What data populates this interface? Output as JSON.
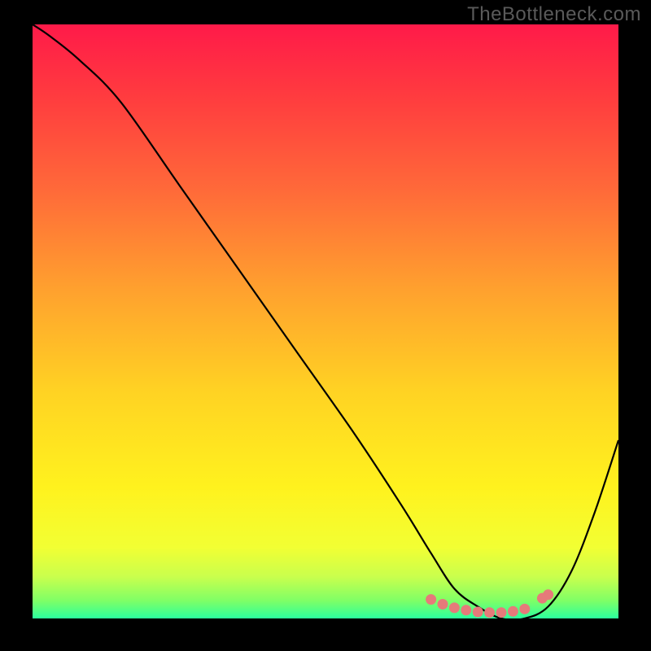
{
  "watermark": "TheBottleneck.com",
  "chart_data": {
    "type": "line",
    "title": "",
    "xlabel": "",
    "ylabel": "",
    "xlim": [
      0,
      100
    ],
    "ylim": [
      0,
      100
    ],
    "grid": false,
    "background_gradient": {
      "stops": [
        {
          "offset": 0.0,
          "color": "#ff1a49"
        },
        {
          "offset": 0.12,
          "color": "#ff3b3f"
        },
        {
          "offset": 0.28,
          "color": "#ff6a39"
        },
        {
          "offset": 0.45,
          "color": "#ffa22e"
        },
        {
          "offset": 0.62,
          "color": "#ffd323"
        },
        {
          "offset": 0.78,
          "color": "#fff21e"
        },
        {
          "offset": 0.88,
          "color": "#f2ff33"
        },
        {
          "offset": 0.93,
          "color": "#c9ff4d"
        },
        {
          "offset": 0.97,
          "color": "#7fff66"
        },
        {
          "offset": 1.0,
          "color": "#2bff9e"
        }
      ]
    },
    "series": [
      {
        "name": "bottleneck-curve",
        "color": "#000000",
        "x": [
          0,
          3,
          8,
          15,
          25,
          35,
          45,
          55,
          63,
          68,
          72,
          76,
          80,
          84,
          88,
          92,
          96,
          100
        ],
        "y": [
          100,
          98,
          94,
          87,
          73,
          59,
          45,
          31,
          19,
          11,
          5,
          2,
          0,
          0,
          2,
          8,
          18,
          30
        ]
      }
    ],
    "markers": {
      "name": "valley-markers",
      "color": "#e67a7a",
      "points": [
        {
          "x": 68,
          "y": 3.2
        },
        {
          "x": 70,
          "y": 2.4
        },
        {
          "x": 72,
          "y": 1.8
        },
        {
          "x": 74,
          "y": 1.4
        },
        {
          "x": 76,
          "y": 1.1
        },
        {
          "x": 78,
          "y": 1.0
        },
        {
          "x": 80,
          "y": 1.0
        },
        {
          "x": 82,
          "y": 1.2
        },
        {
          "x": 84,
          "y": 1.6
        },
        {
          "x": 87,
          "y": 3.4
        },
        {
          "x": 88,
          "y": 4.0
        }
      ]
    }
  }
}
